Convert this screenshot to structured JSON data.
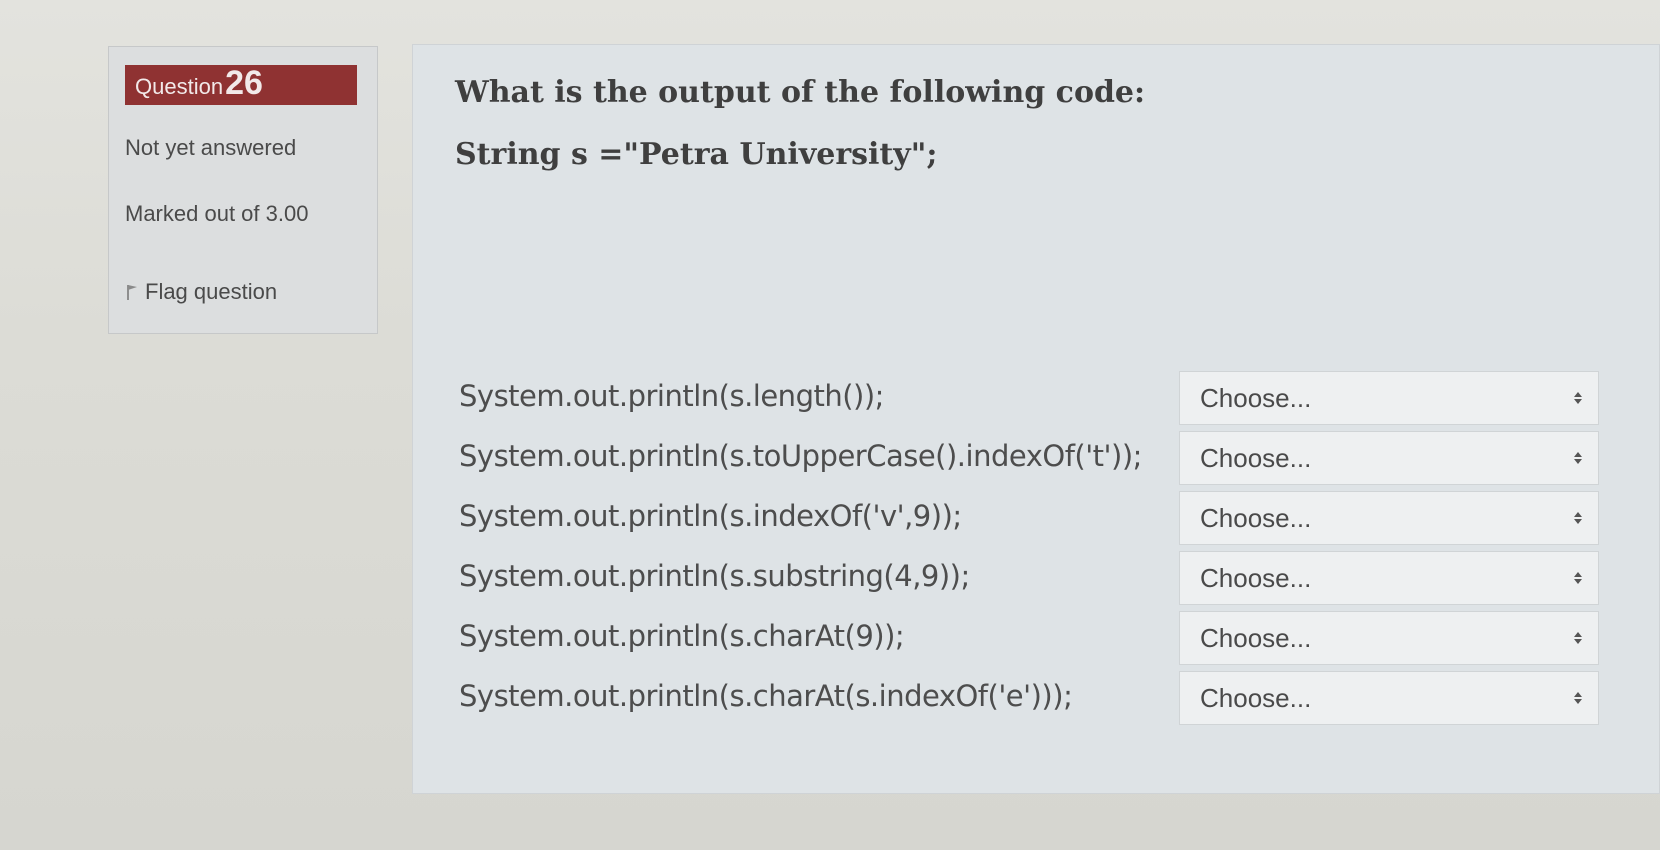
{
  "info": {
    "question_label": "Question",
    "question_number": "26",
    "status": "Not yet answered",
    "marks": "Marked out of 3.00",
    "flag_label": "Flag question"
  },
  "question": {
    "prompt": "What is the output of the following code:",
    "declaration": "String s =\"Petra University\";"
  },
  "rows": [
    {
      "code": "System.out.println(s.length());",
      "selected": "Choose..."
    },
    {
      "code": "System.out.println(s.toUpperCase().indexOf('t'));",
      "selected": "Choose..."
    },
    {
      "code": "System.out.println(s.indexOf('v',9));",
      "selected": "Choose..."
    },
    {
      "code": "System.out.println(s.substring(4,9));",
      "selected": "Choose..."
    },
    {
      "code": "System.out.println(s.charAt(9));",
      "selected": "Choose..."
    },
    {
      "code": "System.out.println(s.charAt(s.indexOf('e')));",
      "selected": "Choose..."
    }
  ],
  "icons": {
    "flag": "flag-icon",
    "select_arrow": "updown-arrows-icon"
  },
  "colors": {
    "question_badge": "#8f3232"
  }
}
